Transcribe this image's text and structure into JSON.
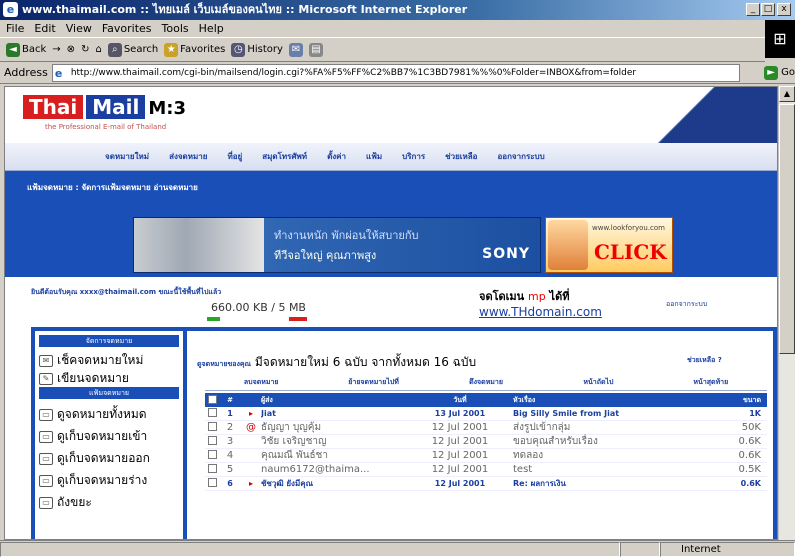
{
  "window": {
    "title": "www.thaimail.com :: ไทยเมล์ เว็บเมล์ของคนไทย :: Microsoft Internet Explorer",
    "min": "_",
    "max": "□",
    "close": "x"
  },
  "menu": [
    "File",
    "Edit",
    "View",
    "Favorites",
    "Tools",
    "Help"
  ],
  "toolbar": {
    "back": "Back",
    "forward": "→",
    "stop": "⊗",
    "refresh": "↻",
    "home": "⌂",
    "search": "Search",
    "favorites": "Favorites",
    "history": "History"
  },
  "address": {
    "label": "Address",
    "url": "http://www.thaimail.com/cgi-bin/mailsend/login.cgi?%FA%F5%FF%C2%BB7%1C3BD7981%%%0%Folder=INBOX&from=folder",
    "go": "Go",
    "links": "Links"
  },
  "status": {
    "left": "",
    "zone": "Internet"
  },
  "page": {
    "logo": {
      "thai": "Thai",
      "mail": "Mail",
      "m": "M:3",
      "tagline": "the Professional E-mail of Thailand"
    },
    "nav": [
      "จดหมายใหม่",
      "ส่งจดหมาย",
      "ที่อยู่",
      "สมุดโทรศัพท์",
      "ตั้งค่า",
      "แฟ้ม",
      "บริการ",
      "ช่วยเหลือ",
      "ออกจากระบบ"
    ],
    "breadcrumb": "แฟ้มจดหมาย : จัดการแฟ้มจดหมาย อ่านจดหมาย",
    "banner": {
      "line1": "ทำงานหนัก พักผ่อนให้สบายกับ",
      "line2": "ทีวีจอใหญ่ คุณภาพสูง",
      "brand": "SONY"
    },
    "click_ad": {
      "url": "www.lookforyou.com",
      "cta": "CLICK"
    },
    "info": {
      "user": "ยินดีต้อนรับคุณ  xxxx@thaimail.com  ขณะนี้ใช้พื้นที่ไปแล้ว",
      "quota": "660.00 KB / 5 MB",
      "domain_text": "จดโดเมน",
      "domain_red": "mp",
      "domain_suffix": " ได้ที่",
      "domain_link": "www.THdomain.com",
      "right": "ออกจากระบบ"
    },
    "quota_used_fraction": 0.13,
    "sidebar": {
      "header1": "จัดการจดหมาย",
      "items_top": [
        "เช็คจดหมายใหม่",
        "เขียนจดหมาย"
      ],
      "header2": "แฟ้มจดหมาย",
      "items_folders": [
        "ดูจดหมายทั้งหมด",
        "ดูเก็บจดหมายเข้า",
        "ดูเก็บจดหมายออก",
        "ดูเก็บจดหมายร่าง",
        "ถังขยะ"
      ]
    },
    "summary": {
      "label": "ดูจดหมายของคุณ",
      "text": "มีจดหมายใหม่ 6 ฉบับ จากทั้งหมด 16 ฉบับ",
      "right": "ช่วยเหลือ ?"
    },
    "folder_tabs": [
      "ลบจดหมาย",
      "ย้ายจดหมายไปที่",
      "ดึงจดหมาย",
      "หน้าถัดไป",
      "หน้าสุดท้าย"
    ],
    "table": {
      "headers": {
        "num": "#",
        "from": "ผู้ส่ง",
        "date": "วันที่",
        "subject": "หัวเรื่อง",
        "size": "ขนาด"
      },
      "rows": [
        {
          "num": "1",
          "flag": "▸",
          "from": "Jiat",
          "date": "13 Jul 2001",
          "subject": "Big Silly Smile  from Jiat",
          "size": "1K",
          "unread": true
        },
        {
          "num": "2",
          "flag": "@",
          "from": "ธัญญา บุญคุ้ม",
          "date": "12 Jul 2001",
          "subject": "ส่งรูปเข้ากลุ่ม",
          "size": "50K",
          "unread": false
        },
        {
          "num": "3",
          "flag": "",
          "from": "วิชัย เจริญชาญ",
          "date": "12 Jul 2001",
          "subject": "ขอบคุณสำหรับเรื่อง",
          "size": "0.6K",
          "unread": false
        },
        {
          "num": "4",
          "flag": "",
          "from": "คุณมณี พันธ์ชา",
          "date": "12 Jul 2001",
          "subject": "ทดลอง",
          "size": "0.6K",
          "unread": false
        },
        {
          "num": "5",
          "flag": "",
          "from": "naum6172@thaima...",
          "date": "12 Jul 2001",
          "subject": "test",
          "size": "0.5K",
          "unread": false
        },
        {
          "num": "6",
          "flag": "▸",
          "from": "ชัชวุฒิ ยังมีคุณ",
          "date": "12 Jul 2001",
          "subject": "Re: ผลการเงิน",
          "size": "0.6K",
          "unread": true
        }
      ]
    }
  },
  "colors": {
    "brand_blue": "#1b4fb8",
    "brand_red": "#d81e1e",
    "titlebar": "#0a246a"
  }
}
